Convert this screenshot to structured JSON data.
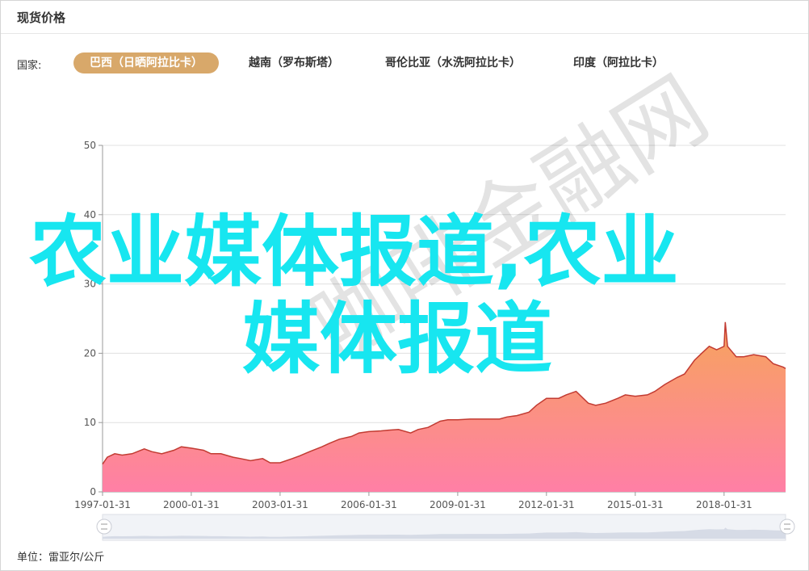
{
  "header": {
    "title": "现货价格"
  },
  "filter": {
    "label": "国家:",
    "options": [
      {
        "label": "巴西（日晒阿拉比卡）",
        "active": true
      },
      {
        "label": "越南（罗布斯塔）",
        "active": false
      },
      {
        "label": "哥伦比亚（水洗阿拉比卡）",
        "active": false
      },
      {
        "label": "印度（阿拉比卡）",
        "active": false
      }
    ]
  },
  "unit": {
    "text": "单位：雷亚尔/公斤"
  },
  "overlay": {
    "line1": "农业媒体报道,农业",
    "line2": "媒体报道"
  },
  "watermark": {
    "text": "咖啡金融网"
  },
  "colors": {
    "accent": "#d8a86a",
    "line": "#c23b32",
    "area_top": "#f7a45c",
    "area_bottom": "#ff7fa6",
    "overlay_text": "#17e6f0"
  },
  "chart_data": {
    "type": "area",
    "title": "",
    "xlabel": "",
    "ylabel": "",
    "ylim": [
      0,
      50
    ],
    "yticks": [
      "0",
      "10",
      "20",
      "30",
      "40",
      "50"
    ],
    "xticks": [
      "1997-01-31",
      "2000-01-31",
      "2003-01-31",
      "2006-01-31",
      "2009-01-31",
      "2012-01-31",
      "2015-01-31",
      "2018-01-31"
    ],
    "xlim": [
      "1997-01-31",
      "2020-02-29"
    ],
    "grid": true,
    "series": [
      {
        "x": [
          "1997-01-31",
          "1997-03-31",
          "1997-06-30",
          "1997-09-30",
          "1998-01-31",
          "1998-06-30",
          "1998-09-30",
          "1999-01-31",
          "1999-06-30",
          "1999-09-30",
          "2000-01-31",
          "2000-06-30",
          "2000-09-30",
          "2001-01-31",
          "2001-06-30",
          "2001-09-30",
          "2002-01-31",
          "2002-06-30",
          "2002-09-30",
          "2003-01-31",
          "2003-06-30",
          "2003-09-30",
          "2004-01-31",
          "2004-06-30",
          "2004-09-30",
          "2005-01-31",
          "2005-06-30",
          "2005-09-30",
          "2006-01-31",
          "2006-06-30",
          "2006-09-30",
          "2007-01-31",
          "2007-06-30",
          "2007-09-30",
          "2008-01-31",
          "2008-06-30",
          "2008-09-30",
          "2009-01-31",
          "2009-06-30",
          "2009-09-30",
          "2010-01-31",
          "2010-06-30",
          "2010-09-30",
          "2011-01-31",
          "2011-06-30",
          "2011-09-30",
          "2012-01-31",
          "2012-06-30",
          "2012-09-30",
          "2013-01-31",
          "2013-06-30",
          "2013-09-30",
          "2014-01-31",
          "2014-06-30",
          "2014-09-30",
          "2015-01-31",
          "2015-06-30",
          "2015-09-30",
          "2016-01-31",
          "2016-06-30",
          "2016-09-30",
          "2017-01-31",
          "2017-04-30",
          "2017-07-31",
          "2017-10-31",
          "2018-01-31",
          "2018-02-15",
          "2018-03-15",
          "2018-06-30",
          "2018-09-30",
          "2019-01-31",
          "2019-06-30",
          "2019-09-30",
          "2020-01-31",
          "2020-02-29"
        ],
        "y": [
          4.0,
          5.0,
          5.5,
          5.3,
          5.5,
          6.2,
          5.8,
          5.5,
          6.0,
          6.5,
          6.3,
          6.0,
          5.5,
          5.5,
          5.0,
          4.8,
          4.5,
          4.8,
          4.2,
          4.2,
          4.8,
          5.2,
          5.8,
          6.5,
          7.0,
          7.6,
          8.0,
          8.5,
          8.7,
          8.8,
          8.9,
          9.0,
          8.5,
          9.0,
          9.3,
          10.2,
          10.4,
          10.4,
          10.5,
          10.5,
          10.5,
          10.5,
          10.8,
          11.0,
          11.5,
          12.5,
          13.5,
          13.5,
          14.0,
          14.5,
          12.8,
          12.5,
          12.8,
          13.5,
          14.0,
          13.8,
          14.0,
          14.5,
          15.5,
          16.5,
          17.0,
          19.0,
          20.0,
          21.0,
          20.5,
          21.0,
          24.5,
          21.0,
          19.5,
          19.5,
          19.8,
          19.5,
          18.5,
          18.0,
          17.8
        ]
      }
    ]
  }
}
